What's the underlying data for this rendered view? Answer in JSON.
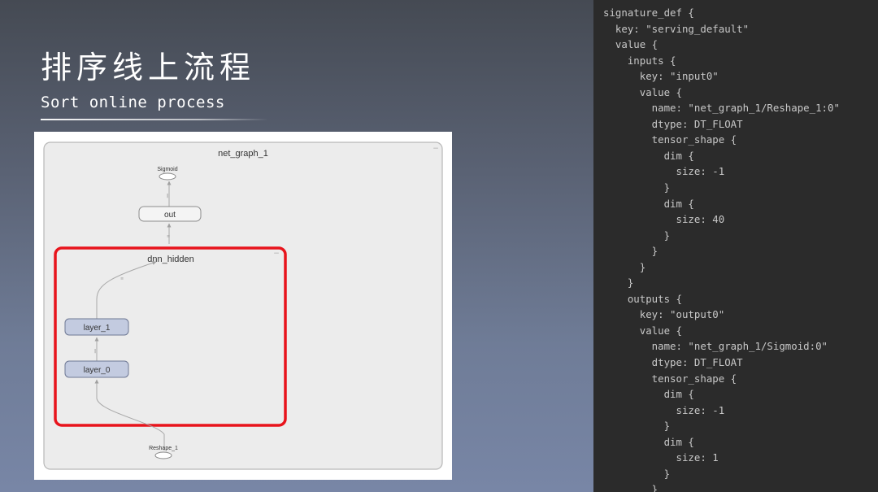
{
  "slide": {
    "title": "排序线上流程",
    "subtitle": "Sort online process"
  },
  "graph": {
    "group_label": "net_graph_1",
    "subgroup_label": "dnn_hidden",
    "nodes": {
      "sigmoid": "Sigmoid",
      "out": "out",
      "layer_1": "layer_1",
      "layer_0": "layer_0",
      "reshape_1": "Reshape_1"
    },
    "highlight_color": "#e8141c",
    "node_fill": "#c3cbe0",
    "group_fill": "#ececec"
  },
  "code": {
    "lines": [
      "signature_def {",
      "  key: \"serving_default\"",
      "  value {",
      "    inputs {",
      "      key: \"input0\"",
      "      value {",
      "        name: \"net_graph_1/Reshape_1:0\"",
      "        dtype: DT_FLOAT",
      "        tensor_shape {",
      "          dim {",
      "            size: -1",
      "          }",
      "          dim {",
      "            size: 40",
      "          }",
      "        }",
      "      }",
      "    }",
      "    outputs {",
      "      key: \"output0\"",
      "      value {",
      "        name: \"net_graph_1/Sigmoid:0\"",
      "        dtype: DT_FLOAT",
      "        tensor_shape {",
      "          dim {",
      "            size: -1",
      "          }",
      "          dim {",
      "            size: 1",
      "          }",
      "        }"
    ]
  }
}
